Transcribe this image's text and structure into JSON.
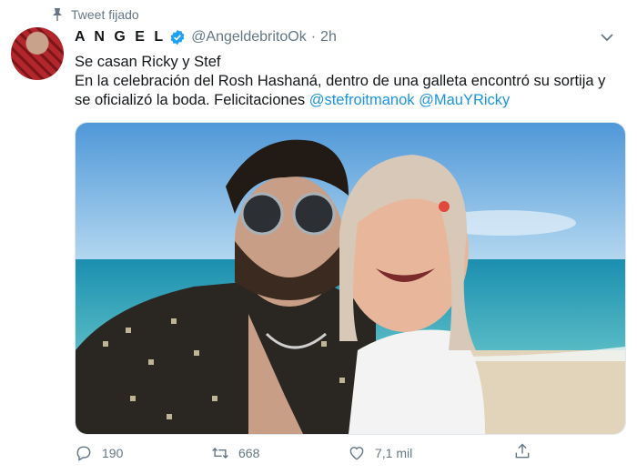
{
  "pinned_label": "Tweet fijado",
  "icons": {
    "pin": "pin-icon",
    "verified": "verified-badge-icon",
    "caret": "chevron-down-icon",
    "reply": "reply-icon",
    "retweet": "retweet-icon",
    "like": "like-icon",
    "share": "share-icon"
  },
  "author": {
    "name": "A N G E L",
    "handle": "@AngeldebritoOk",
    "separator": "·",
    "time": "2h"
  },
  "tweet": {
    "line1": "Se casan Ricky y Stef",
    "line2_text": "En la celebración del Rosh Hashaná, dentro de una galleta encontró su sortija y se oficializó la boda. Felicitaciones ",
    "mention1": "@stefroitmanok",
    "mention2": "@MauYRicky"
  },
  "stats": {
    "replies": "190",
    "retweets": "668",
    "likes": "7,1 mil"
  },
  "colors": {
    "link": "#1b95e0",
    "muted": "#657786",
    "text": "#14171a",
    "verified": "#1da1f2"
  }
}
